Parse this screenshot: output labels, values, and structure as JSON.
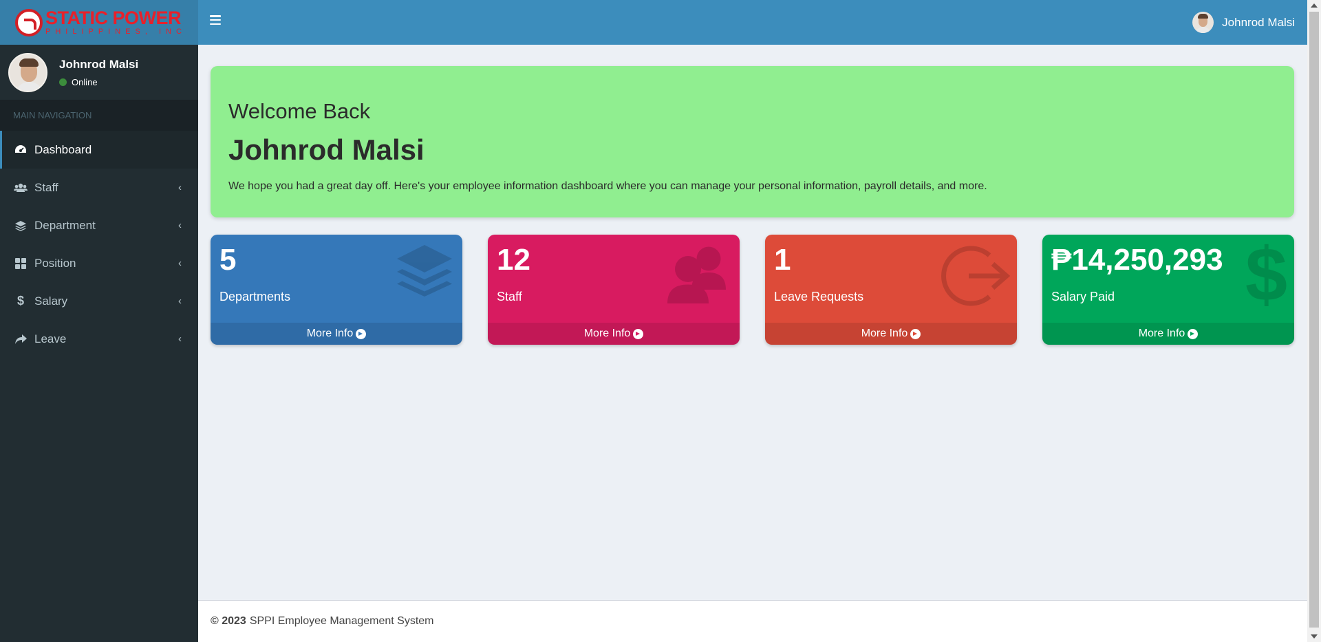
{
  "brand": {
    "title": "STATIC POWER",
    "subtitle": "PHILIPPINES, INC",
    "color": "#e8202a"
  },
  "user": {
    "name": "Johnrod Malsi",
    "status": "Online",
    "status_color": "#3c8d3c"
  },
  "sidebar": {
    "header": "MAIN NAVIGATION",
    "items": [
      {
        "label": "Dashboard",
        "icon": "dashboard-icon",
        "active": true
      },
      {
        "label": "Staff",
        "icon": "users-icon"
      },
      {
        "label": "Department",
        "icon": "layers-icon"
      },
      {
        "label": "Position",
        "icon": "grid-icon"
      },
      {
        "label": "Salary",
        "icon": "dollar-icon"
      },
      {
        "label": "Leave",
        "icon": "share-icon"
      }
    ]
  },
  "header": {
    "user_name": "Johnrod Malsi"
  },
  "welcome": {
    "greeting": "Welcome Back",
    "name": "Johnrod Malsi",
    "message": "We hope you had a great day off. Here's your employee information dashboard where you can manage your personal information, payroll details, and more."
  },
  "cards": [
    {
      "value": "5",
      "label": "Departments",
      "footer": "More Info",
      "color": "#3578b9",
      "icon": "layers-icon"
    },
    {
      "value": "12",
      "label": "Staff",
      "footer": "More Info",
      "color": "#d81b60",
      "icon": "users-icon"
    },
    {
      "value": "1",
      "label": "Leave Requests",
      "footer": "More Info",
      "color": "#dd4b39",
      "icon": "sign-out-icon"
    },
    {
      "value": "₱14,250,293",
      "label": "Salary Paid",
      "footer": "More Info",
      "color": "#00a65a",
      "icon": "dollar-icon"
    }
  ],
  "footer": {
    "year": "© 2023",
    "text": "SPPI Employee Management System"
  }
}
